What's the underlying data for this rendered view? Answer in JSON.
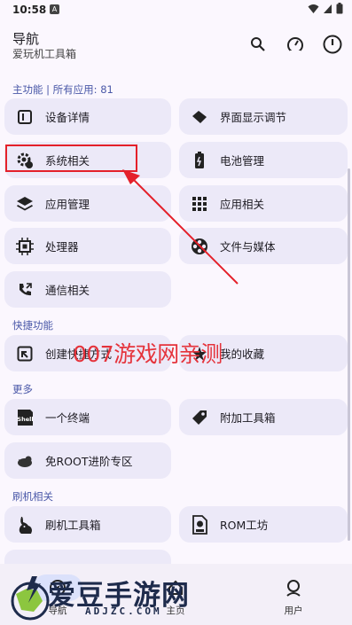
{
  "status_bar": {
    "time": "10:58",
    "notification_letter": "A"
  },
  "appbar": {
    "title": "导航",
    "subtitle": "爱玩机工具箱"
  },
  "sections": {
    "main": "主功能 | 所有应用: 81",
    "shortcuts": "快捷功能",
    "more": "更多",
    "flash": "刷机相关"
  },
  "cards": {
    "device_details": "设备详情",
    "display_adjust": "界面显示调节",
    "system": "系统相关",
    "battery": "电池管理",
    "app_manage": "应用管理",
    "app_related": "应用相关",
    "processor": "处理器",
    "file_media": "文件与媒体",
    "call_related": "通信相关",
    "create_shortcut": "创建快捷方式",
    "shortcut2": "我的收藏",
    "terminal": "一个终端",
    "extra_tools": "附加工具箱",
    "no_root": "免ROOT进阶专区",
    "flash_tools": "刷机工具箱",
    "rom_workshop": "ROM工坊"
  },
  "watermark": "007游戏网亲测",
  "bottom_nav": {
    "nav": "导航",
    "home": "主页",
    "user": "用户"
  },
  "logo": {
    "name": "爱豆手游网",
    "domain": "ADJZC.COM"
  },
  "colors": {
    "accent": "#4a58a8",
    "card_bg": "#ece9f8",
    "highlight_red": "#e4202a",
    "watermark_red": "#e5333b"
  }
}
